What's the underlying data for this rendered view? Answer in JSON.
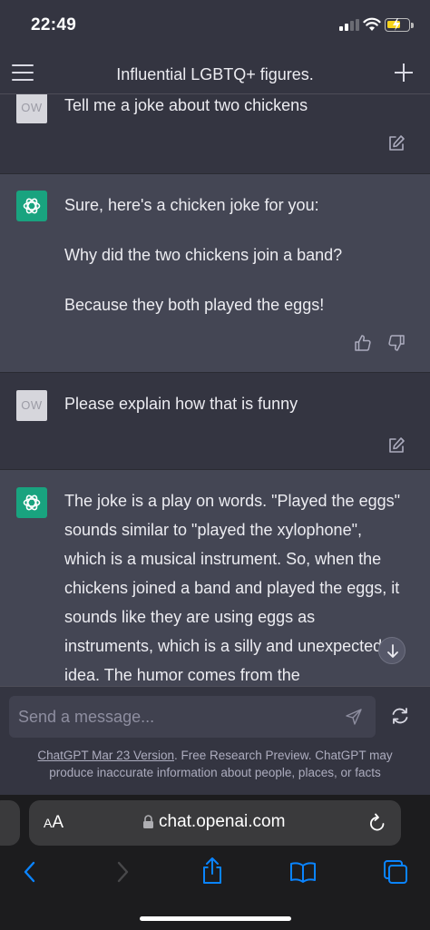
{
  "status_bar": {
    "time": "22:49"
  },
  "header": {
    "menu_icon": "hamburger-menu-icon",
    "title": "Influential LGBTQ+ figures.",
    "new_chat_icon": "plus-icon"
  },
  "conversation": {
    "messages": [
      {
        "role": "user",
        "avatar_initials": "OW",
        "text": "Tell me a joke about two chickens"
      },
      {
        "role": "assistant",
        "paragraphs": [
          "Sure, here's a chicken joke for you:",
          "Why did the two chickens join a band?",
          "Because they both played the eggs!"
        ]
      },
      {
        "role": "user",
        "avatar_initials": "OW",
        "text": "Please explain how that is funny"
      },
      {
        "role": "assistant",
        "paragraphs": [
          "The joke is a play on words. \"Played the eggs\" sounds similar to \"played the xylophone\", which is a musical instrument. So, when the chickens joined a band and played the eggs, it sounds like they are using eggs as instruments, which is a silly and unexpected idea. The humor comes from the"
        ]
      }
    ]
  },
  "composer": {
    "placeholder": "Send a message...",
    "disclaimer_link": "ChatGPT Mar 23 Version",
    "disclaimer_text": ". Free Research Preview. ChatGPT may produce inaccurate information about people, places, or facts"
  },
  "browser": {
    "text_size_label_small": "A",
    "text_size_label_large": "A",
    "url": "chat.openai.com",
    "icons": [
      "back-icon",
      "forward-icon",
      "share-icon",
      "bookmarks-icon",
      "tabs-icon"
    ]
  },
  "colors": {
    "background": "#343541",
    "assistant_background": "#444654",
    "assistant_avatar": "#19a37f",
    "ios_blue": "#0a84ff"
  }
}
